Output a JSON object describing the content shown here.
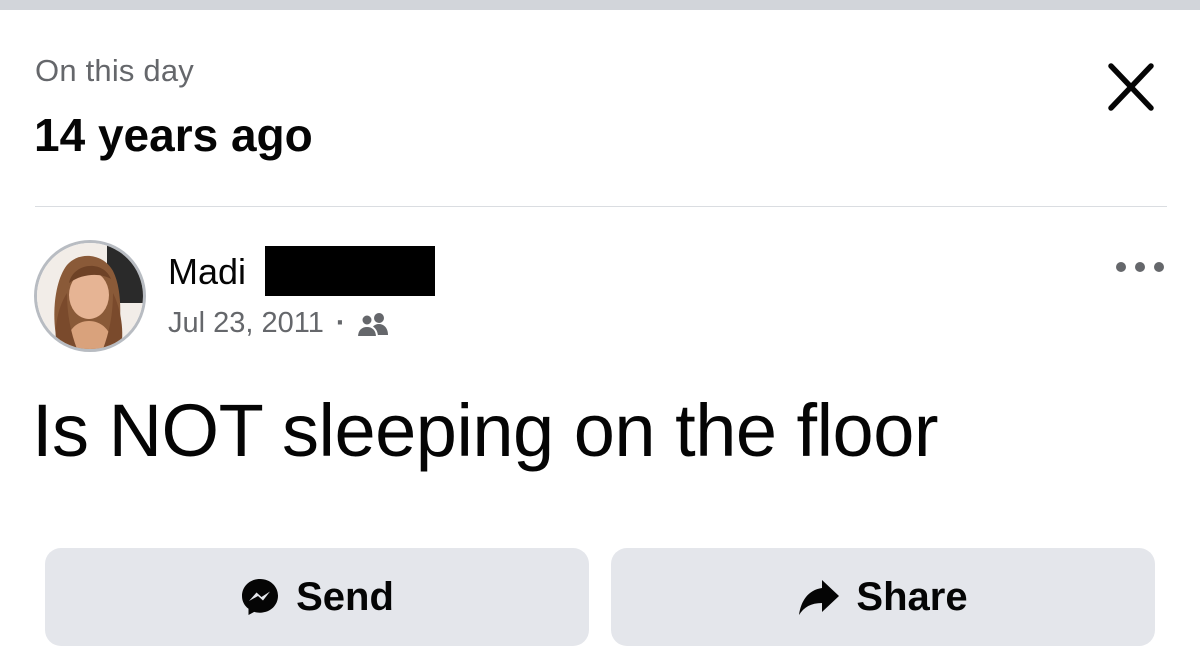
{
  "memory": {
    "kicker": "On this day",
    "headline": "14 years ago"
  },
  "post": {
    "author_visible_name": "Madi",
    "date": "Jul 23, 2011",
    "separator": "·",
    "audience_icon": "friends-icon",
    "text": "Is NOT sleeping on the floor"
  },
  "actions": {
    "send_label": "Send",
    "share_label": "Share"
  },
  "icons": {
    "close": "close-icon",
    "more": "more-options-icon",
    "send": "messenger-icon",
    "share": "share-arrow-icon"
  },
  "colors": {
    "primary_text": "#050505",
    "secondary_text": "#65676b",
    "button_bg": "#e4e6eb",
    "divider": "#dadde1"
  }
}
